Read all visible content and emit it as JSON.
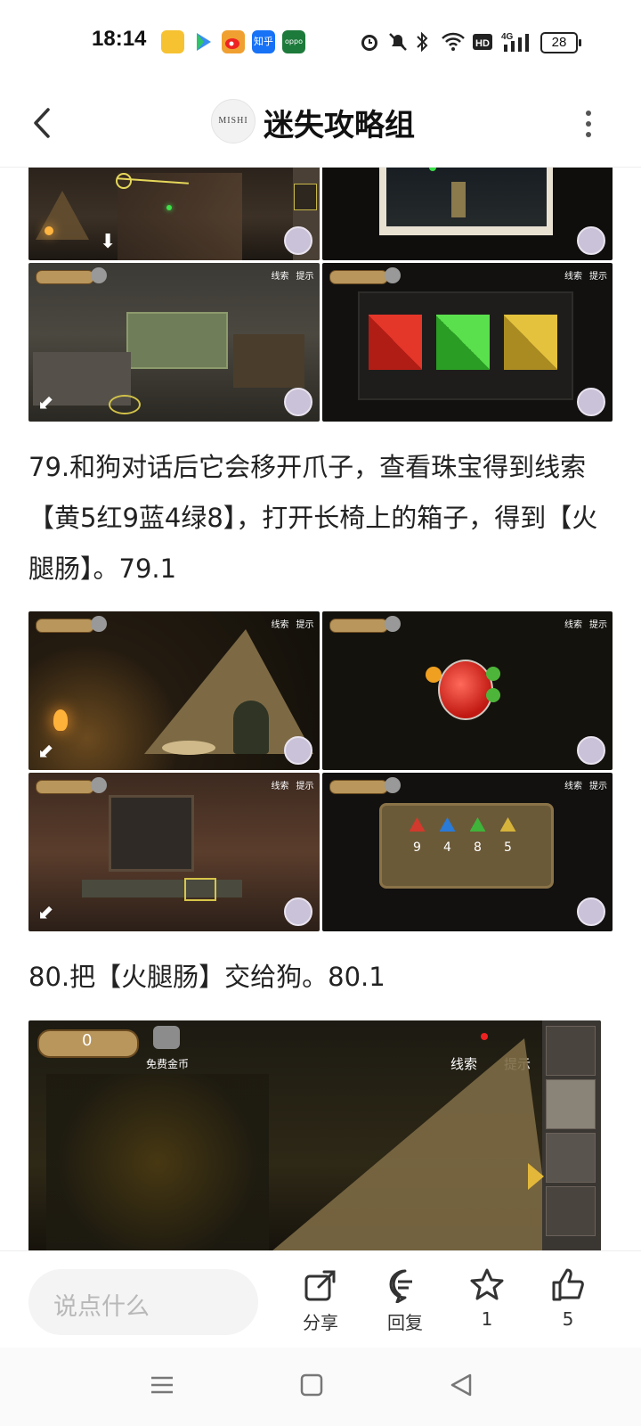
{
  "status_bar": {
    "time": "18:14",
    "app_icons": [
      {
        "name": "notes-app-icon",
        "color": "#f6c232"
      },
      {
        "name": "play-app-icon",
        "color": "#3a8ef0"
      },
      {
        "name": "weibo-app-icon",
        "color": "#f0a030"
      },
      {
        "name": "zhihu-app-icon",
        "color": "#1772f6",
        "text": "知乎"
      },
      {
        "name": "oppo-app-icon",
        "color": "#1c7a3a",
        "text": "oppo"
      }
    ],
    "battery": "28"
  },
  "header": {
    "logo_text": "MISHI",
    "title": "迷失攻略组"
  },
  "article": {
    "para_79": "79.和狗对话后它会移开爪子，查看珠宝得到线索【黄5红9蓝4绿8】，打开长椅上的箱子，得到【火腿肠】。79.1",
    "para_80": "80.把【火腿肠】交给狗。80.1",
    "gem_numbers": [
      "9",
      "4",
      "8",
      "5"
    ],
    "hud_labels": {
      "coins": "免费金币",
      "clues": "线索",
      "hint": "提示",
      "coin_value": "0"
    }
  },
  "bottom_bar": {
    "comment_placeholder": "说点什么",
    "share_label": "分享",
    "reply_label": "回复",
    "favorite_count": "1",
    "like_count": "5"
  },
  "colors": {
    "accent_red": "#d63a2a",
    "accent_green": "#3ec43a",
    "accent_yellow": "#d8b02e"
  }
}
